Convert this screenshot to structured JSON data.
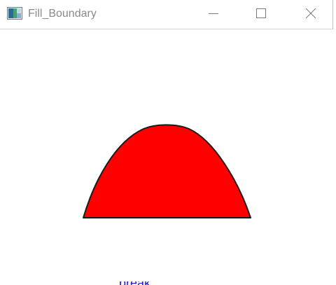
{
  "window": {
    "title": "Fill_Boundary",
    "app_icon": "app-icon"
  },
  "controls": {
    "minimize_icon": "minimize-icon",
    "maximize_icon": "maximize-icon",
    "close_icon": "close-icon"
  },
  "drawing": {
    "shape": "filled-arch",
    "fill_color": "#ff0000",
    "boundary_color": "#1a1a1a"
  },
  "background_app": {
    "partial_text": "break",
    "text_color": "#1e1ed2"
  }
}
